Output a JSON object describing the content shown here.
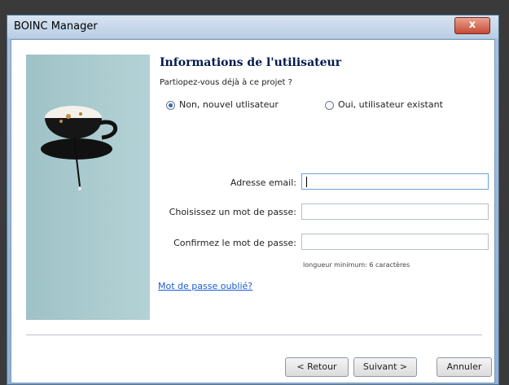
{
  "window": {
    "title": "BOINC Manager",
    "close_glyph": "x"
  },
  "wizard": {
    "heading": "Informations de l'utilisateur",
    "question": "Partiopez-vous déjà à ce projet ?",
    "radio_new": {
      "label": "Non, nouvel utlisateur",
      "checked": true
    },
    "radio_existing": {
      "label": "Oui, utilisateur existant",
      "checked": false
    },
    "fields": {
      "email": {
        "label": "Adresse email:",
        "value": ""
      },
      "password": {
        "label": "Choisissez un mot de passe:",
        "value": ""
      },
      "confirm": {
        "label": "Confirmez le mot de passe:",
        "value": ""
      }
    },
    "min_length_hint": "longueur minimum: 6 caractères",
    "forgot_link": "Mot de passe oublié?"
  },
  "buttons": {
    "back": "< Retour",
    "next": "Suivant >",
    "cancel": "Annuler"
  },
  "icons": {
    "side_image": "coffee-cup-illustration"
  }
}
